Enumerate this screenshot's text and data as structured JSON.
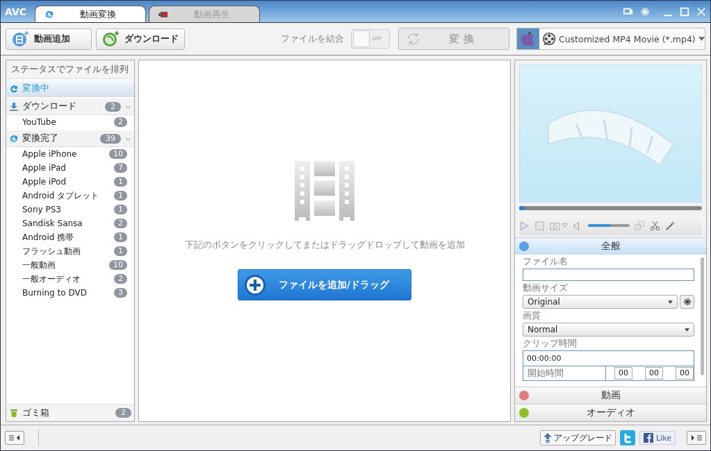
{
  "app_logo": "AVC",
  "tabs": [
    {
      "label": "動画変換",
      "selected": true,
      "kind": "convert"
    },
    {
      "label": "動画再生",
      "selected": false,
      "kind": "play"
    }
  ],
  "toolbar": {
    "add_video": "動画追加",
    "download": "ダウンロード",
    "merge_label": "ファイルを結合",
    "merge_toggle": {
      "label": "OFF",
      "on": false
    },
    "convert": "変 換",
    "profile": "Customized MP4 Movie (*.mp4)"
  },
  "sidebar": {
    "header": "ステータスでファイルを排列",
    "groups": [
      {
        "label": "変換中",
        "kind": "converting",
        "selected": true
      },
      {
        "label": "ダウンロード",
        "kind": "download",
        "count": "2",
        "selected": false,
        "items": [
          {
            "label": "YouTube",
            "count": "2"
          }
        ]
      },
      {
        "label": "変換完了",
        "kind": "done",
        "count": "39",
        "selected": false,
        "items": [
          {
            "label": "Apple iPhone",
            "count": "10"
          },
          {
            "label": "Apple iPad",
            "count": "7"
          },
          {
            "label": "Apple iPod",
            "count": "1"
          },
          {
            "label": "Android タブレット",
            "count": "1"
          },
          {
            "label": "Sony PS3",
            "count": "1"
          },
          {
            "label": "Sandisk Sansa",
            "count": "2"
          },
          {
            "label": "Android 携帯",
            "count": "1"
          },
          {
            "label": "フラッシュ動画",
            "count": "1"
          },
          {
            "label": "一般動画",
            "count": "10"
          },
          {
            "label": "一般オーディオ",
            "count": "2"
          },
          {
            "label": "Burning to DVD",
            "count": "3"
          }
        ]
      }
    ],
    "trash": {
      "label": "ゴミ箱",
      "count": "2"
    }
  },
  "center": {
    "hint": "下記のボタンをクリックしてまたはドラッグドロップして動画を追加",
    "add_button": "ファイルを追加/ドラッグ"
  },
  "preview": {
    "seek": {
      "level": 0.0
    },
    "volume": {
      "level": 0.55
    }
  },
  "settings": {
    "sections": [
      {
        "title": "全般",
        "kind": "general",
        "expanded": true
      },
      {
        "title": "動画",
        "kind": "video",
        "expanded": false
      },
      {
        "title": "オーディオ",
        "kind": "audio",
        "expanded": false
      }
    ],
    "fields": [
      {
        "label": "ファイル名",
        "kind": "text"
      },
      {
        "label": "動画サイズ",
        "kind": "select",
        "value": "Original",
        "gear": true
      },
      {
        "label": "画質",
        "kind": "select",
        "value": "Normal",
        "gear": false
      },
      {
        "label": "クリップ時間",
        "kind": "clip",
        "value": "00:00:00",
        "start_label": "開始時間",
        "start": [
          "00",
          "00",
          "00"
        ]
      }
    ]
  },
  "footer": {
    "upgrade": "アップグレード",
    "like": "Like"
  }
}
